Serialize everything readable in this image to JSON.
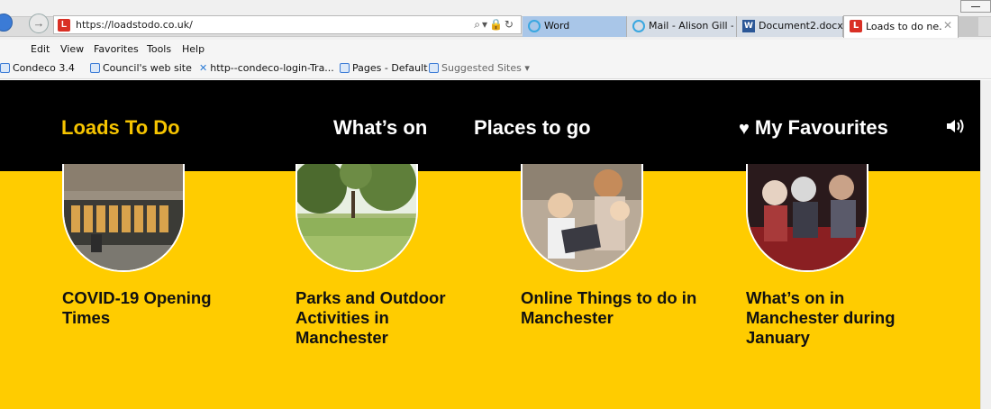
{
  "browser": {
    "url": "https://loadstodo.co.uk/",
    "tabs": [
      {
        "label": "Word"
      },
      {
        "label": "Mail - Alison Gill -..."
      },
      {
        "label": "Document2.docx"
      },
      {
        "label": "Loads to do ne..."
      }
    ],
    "menu": [
      "Edit",
      "View",
      "Favorites",
      "Tools",
      "Help"
    ],
    "favorites": [
      "Condeco 3.4",
      "Council's web site",
      "http--condeco-login-Tra...",
      "Pages - Default",
      "Suggested Sites ▾"
    ]
  },
  "site": {
    "logo": "Loads To Do",
    "nav": {
      "whats_on": "What’s on",
      "places": "Places to go",
      "favourites": "My Favourites"
    },
    "colors": {
      "brand_yellow": "#ffcc00",
      "header_bg": "#000000",
      "logo_color": "#f6c400"
    }
  },
  "cards": [
    {
      "title": "COVID-19 Opening Times"
    },
    {
      "title": "Parks and Outdoor Activities in Manchester"
    },
    {
      "title": "Online Things to do in Manchester"
    },
    {
      "title": "What’s on in Manchester during January"
    }
  ]
}
